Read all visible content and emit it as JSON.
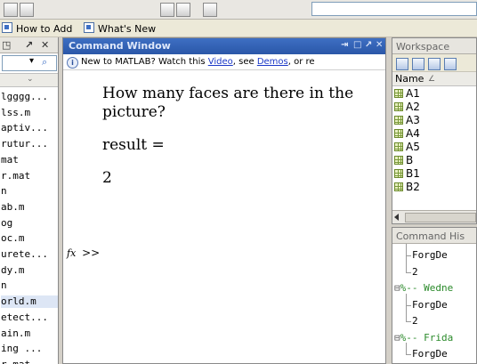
{
  "shortcuts": {
    "items": [
      {
        "label": "How to Add"
      },
      {
        "label": "What's New"
      }
    ]
  },
  "left_panel": {
    "files": [
      "lgggg...",
      "lss.m",
      "aptiv...",
      "rutur...",
      "mat",
      "r.mat",
      "n",
      "ab.m",
      "og",
      "oc.m",
      "urete...",
      "dy.m",
      "n",
      "orld.m",
      "etect...",
      "ain.m",
      "ing ...",
      "r.mat"
    ],
    "selected_index": 13
  },
  "command_window": {
    "title": "Command Window",
    "info": {
      "prefix": "New to MATLAB? Watch this ",
      "video_link": "Video",
      "mid": ", see ",
      "demos_link": "Demos",
      "suffix": ", or re"
    },
    "output": {
      "question": "How many faces are there in the picture?",
      "result_label": "result =",
      "result_value": "2"
    },
    "prompt_icon": "fx",
    "prompt": ">>"
  },
  "workspace": {
    "title": "Workspace",
    "column_name": "Name",
    "sort_indicator": "∠",
    "variables": [
      "A1",
      "A2",
      "A3",
      "A4",
      "A5",
      "B",
      "B1",
      "B2"
    ]
  },
  "history": {
    "title": "Command His",
    "rows": [
      {
        "text": "ForgDe",
        "type": "cmd"
      },
      {
        "text": "2",
        "type": "cmd"
      },
      {
        "text": "%-- Wedne",
        "type": "date"
      },
      {
        "text": "ForgDe",
        "type": "cmd"
      },
      {
        "text": "2",
        "type": "cmd"
      },
      {
        "text": "%-- Frida",
        "type": "date"
      },
      {
        "text": "ForgDe",
        "type": "cmd"
      }
    ]
  },
  "colors": {
    "title_bar": "#2a57a8",
    "link": "#1c39c7",
    "history_date": "#2a8a2a",
    "variable_icon": "#7a9a3a"
  }
}
